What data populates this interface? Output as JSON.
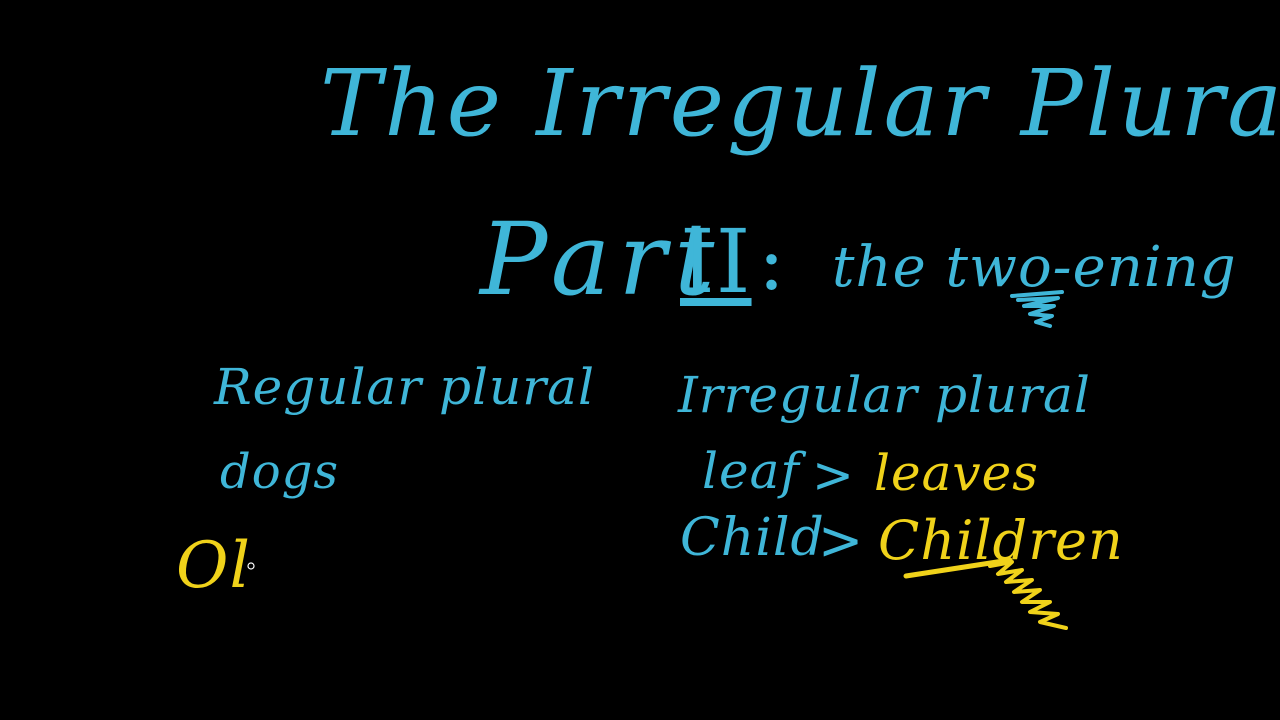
{
  "colors": {
    "background": "#000000",
    "chalk_blue": "#3fb6d8",
    "chalk_yellow": "#f0d21a"
  },
  "board": {
    "title": "The Irregular Plural,",
    "part_word": "Part",
    "part_numeral": "II",
    "part_colon": ":",
    "subtitle": "the two-ening",
    "left_column": {
      "header": "Regular plural",
      "example": "dogs",
      "partial_word": "Ol"
    },
    "right_column": {
      "header": "Irregular plural",
      "row1_singular": "leaf",
      "row1_arrow": ">",
      "row1_plural": "leaves",
      "row2_singular": "Child",
      "row2_arrow": ">",
      "row2_plural": "Children"
    }
  }
}
